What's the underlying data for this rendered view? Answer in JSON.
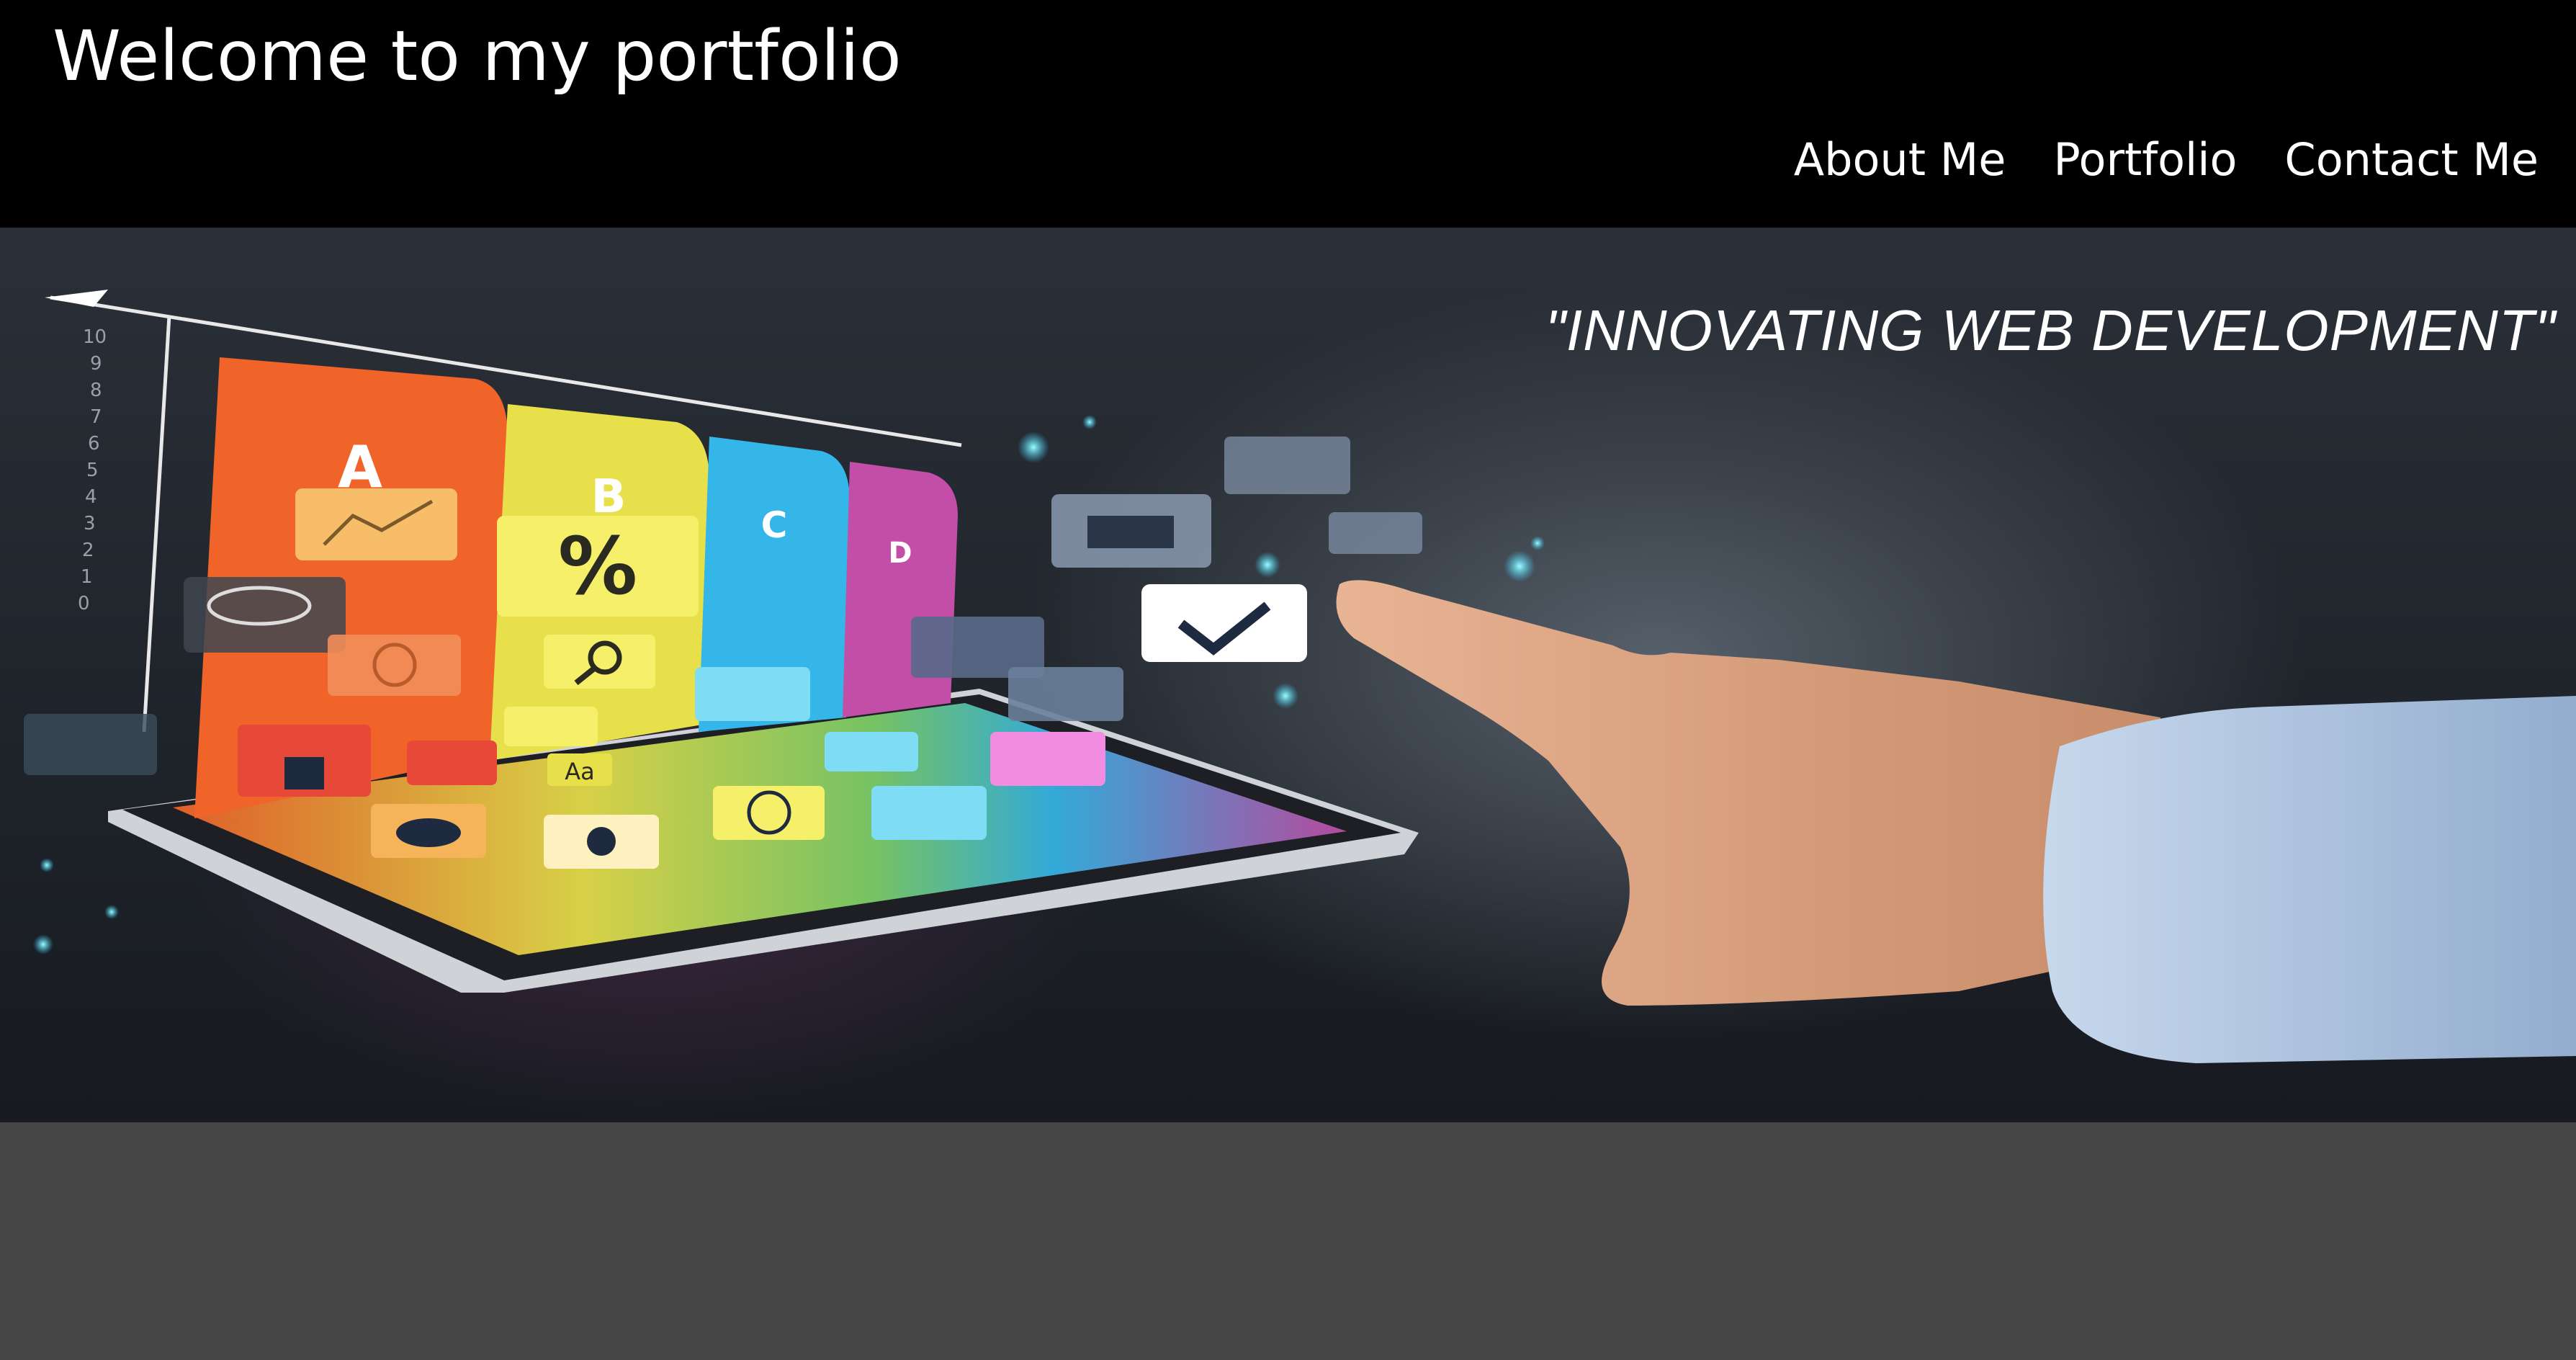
{
  "header": {
    "title": "Welcome to my portfolio",
    "nav": [
      {
        "label": "About Me"
      },
      {
        "label": "Portfolio"
      },
      {
        "label": "Contact Me"
      }
    ]
  },
  "hero": {
    "tagline": "\"INNOVATING WEB DEVELOPMENT\"",
    "image": {
      "tab_letters": [
        "A",
        "B",
        "C",
        "D"
      ],
      "scale_labels": [
        "10",
        "9",
        "8",
        "7",
        "6",
        "5",
        "4",
        "3",
        "2",
        "1",
        "0"
      ],
      "percent_label": "%",
      "font_label": "Aa",
      "icons": [
        "chart-icon",
        "percent-icon",
        "magnifier-icon",
        "rss-icon",
        "users-icon",
        "chat-icon",
        "clock-icon",
        "lock-icon",
        "unlock-icon",
        "music-icon",
        "cloud-icon",
        "gears-icon",
        "globe-icon",
        "group-icon",
        "camera-icon",
        "share-icon",
        "download-icon",
        "cart-icon",
        "check-icon",
        "mail-icon",
        "headphones-icon",
        "keyboard-icon"
      ],
      "colors": {
        "orange": "#f0642a",
        "yellow": "#e8e04a",
        "blue": "#35b6e8",
        "purple": "#c24ea8"
      }
    }
  }
}
